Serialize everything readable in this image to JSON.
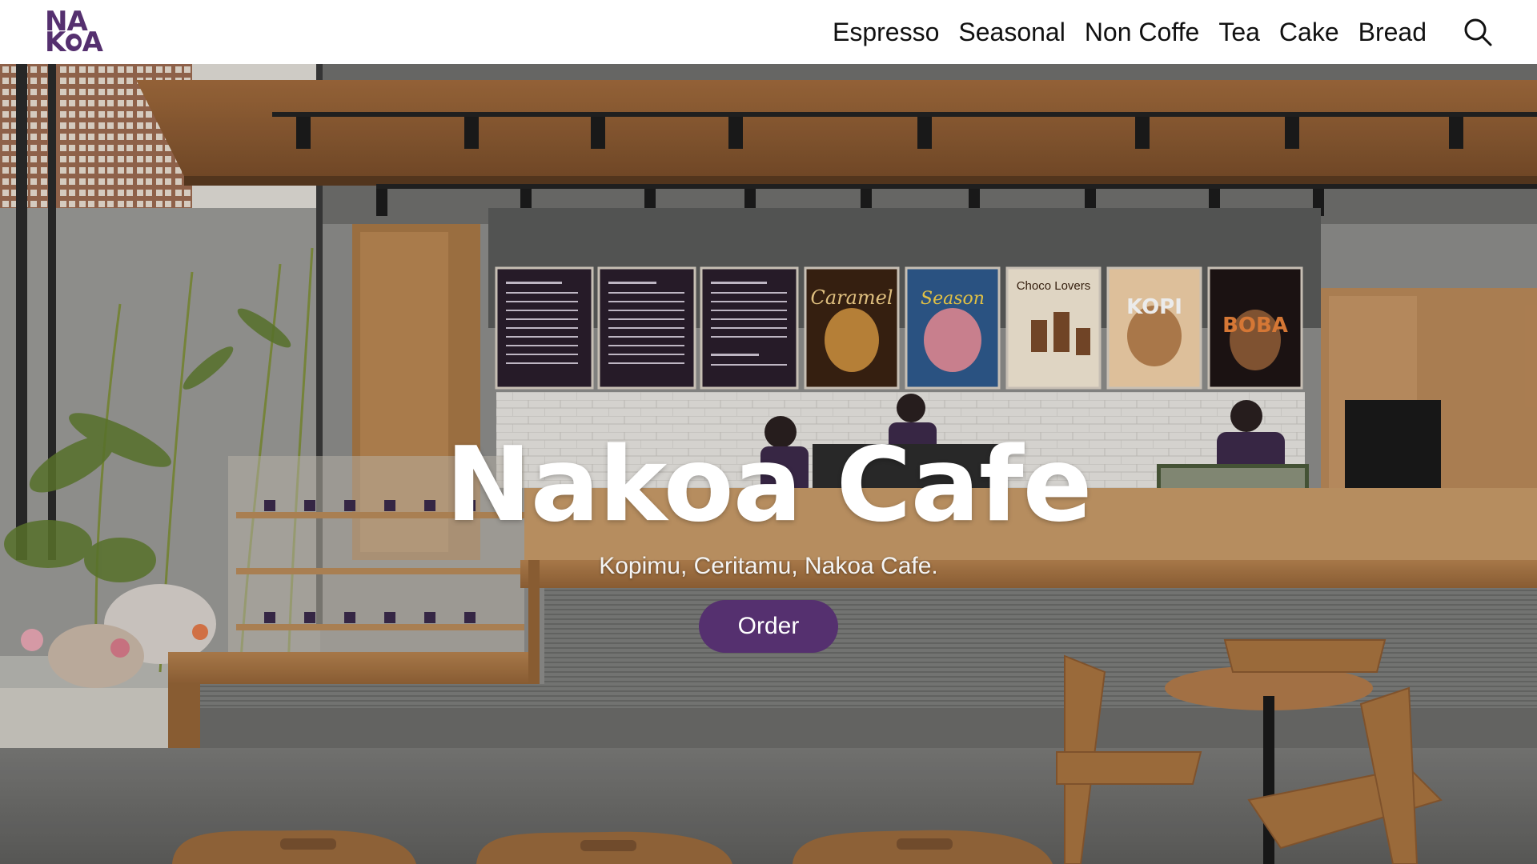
{
  "brand": {
    "logo_line1": "NA",
    "logo_line2_left": "K",
    "logo_line2_right": "A",
    "color": "#55306f"
  },
  "nav": {
    "items": [
      {
        "label": "Espresso"
      },
      {
        "label": "Seasonal"
      },
      {
        "label": "Non Coffe"
      },
      {
        "label": "Tea"
      },
      {
        "label": "Cake"
      },
      {
        "label": "Bread"
      }
    ],
    "search_icon": "search-icon"
  },
  "hero": {
    "title": "Nakoa Cafe",
    "subtitle": "Kopimu, Ceritamu, Nakoa Cafe.",
    "cta_label": "Order",
    "cta_color": "#55306f",
    "background": "cafe interior photo"
  },
  "menu_boards": {
    "boards": [
      {
        "heading": "ESPRESSO BASED"
      },
      {
        "heading": "NON COFFEE"
      },
      {
        "heading": "SEASONAL MENU"
      }
    ],
    "posters": [
      {
        "text": "Caramel"
      },
      {
        "text": "Season"
      },
      {
        "text": "Choco Lovers"
      },
      {
        "text": "KOPI"
      },
      {
        "text": "BOBA"
      }
    ]
  }
}
